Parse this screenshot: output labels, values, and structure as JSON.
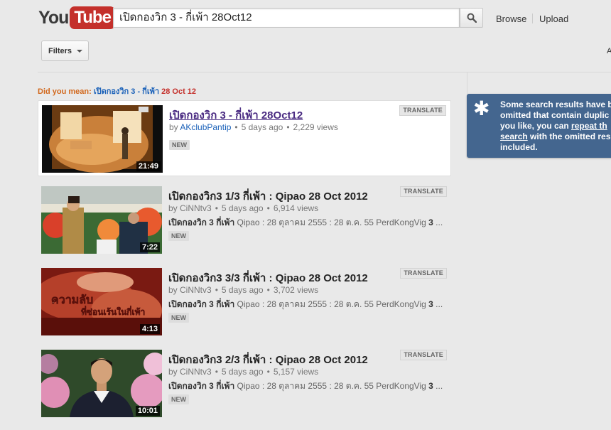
{
  "header": {
    "logo_you": "You",
    "logo_tube": "Tube",
    "search_value": "เปิดกองวิก 3 - กี่เพ้า 28Oct12",
    "nav": {
      "browse": "Browse",
      "upload": "Upload"
    }
  },
  "toolbar": {
    "filters_label": "Filters",
    "edge_text": "A"
  },
  "did_you_mean": {
    "label": "Did you mean:",
    "suggestion_parts": [
      "เปิดกองวิก 3 - กี่เพ้า ",
      "28",
      " ",
      "Oct",
      " ",
      "12"
    ]
  },
  "results": [
    {
      "title": "เปิดกองวิก 3 - กี่เพ้า 28Oct12",
      "uploader": "AKclubPantip",
      "age": "5 days ago",
      "views": "2,229 views",
      "description_bold": "",
      "description_rest": "",
      "badge": "NEW",
      "duration": "21:49",
      "translate": "TRANSLATE"
    },
    {
      "title": "เปิดกองวิก3 1/3 กี่เพ้า : Qipao 28 Oct 2012",
      "uploader": "CiNNtv3",
      "age": "5 days ago",
      "views": "6,914 views",
      "description_bold": "เปิดกองวิก 3 กี่เพ้า",
      "description_rest": " Qipao : 28 ตุลาคม 2555 : 28 ต.ค. 55 PerdKongVig ",
      "description_tail_bold": "3",
      "description_ellipsis": " ...",
      "badge": "NEW",
      "duration": "7:22",
      "translate": "TRANSLATE"
    },
    {
      "title": "เปิดกองวิก3 3/3 กี่เพ้า : Qipao 28 Oct 2012",
      "uploader": "CiNNtv3",
      "age": "5 days ago",
      "views": "3,702 views",
      "description_bold": "เปิดกองวิก 3 กี่เพ้า",
      "description_rest": " Qipao : 28 ตุลาคม 2555 : 28 ต.ค. 55 PerdKongVig ",
      "description_tail_bold": "3",
      "description_ellipsis": " ...",
      "badge": "NEW",
      "duration": "4:13",
      "translate": "TRANSLATE",
      "thumb_caption_1": "ความลับ",
      "thumb_caption_2": "ที่ซ่อนเร้นในกี่เพ้า"
    },
    {
      "title": "เปิดกองวิก3 2/3 กี่เพ้า : Qipao 28 Oct 2012",
      "uploader": "CiNNtv3",
      "age": "5 days ago",
      "views": "5,157 views",
      "description_bold": "เปิดกองวิก 3 กี่เพ้า",
      "description_rest": " Qipao : 28 ตุลาคม 2555 : 28 ต.ค. 55 PerdKongVig ",
      "description_tail_bold": "3",
      "description_ellipsis": " ...",
      "badge": "NEW",
      "duration": "10:01",
      "translate": "TRANSLATE"
    }
  ],
  "info_box": {
    "icon": "asterisk-icon",
    "line1": "Some search results have b",
    "line2": "omitted that contain duplic",
    "line3_pre": "you like, you can ",
    "line3_link": "repeat th",
    "line4_link": "search",
    "line4_post": " with the omitted res",
    "line5": "included."
  },
  "colors": {
    "logo_red": "#c4302b",
    "link_blue": "#1c62b9",
    "visited_purple": "#4a2b82",
    "dym_orange": "#d2691e",
    "info_bg": "#44668f",
    "page_bg": "#e9e9e9"
  }
}
